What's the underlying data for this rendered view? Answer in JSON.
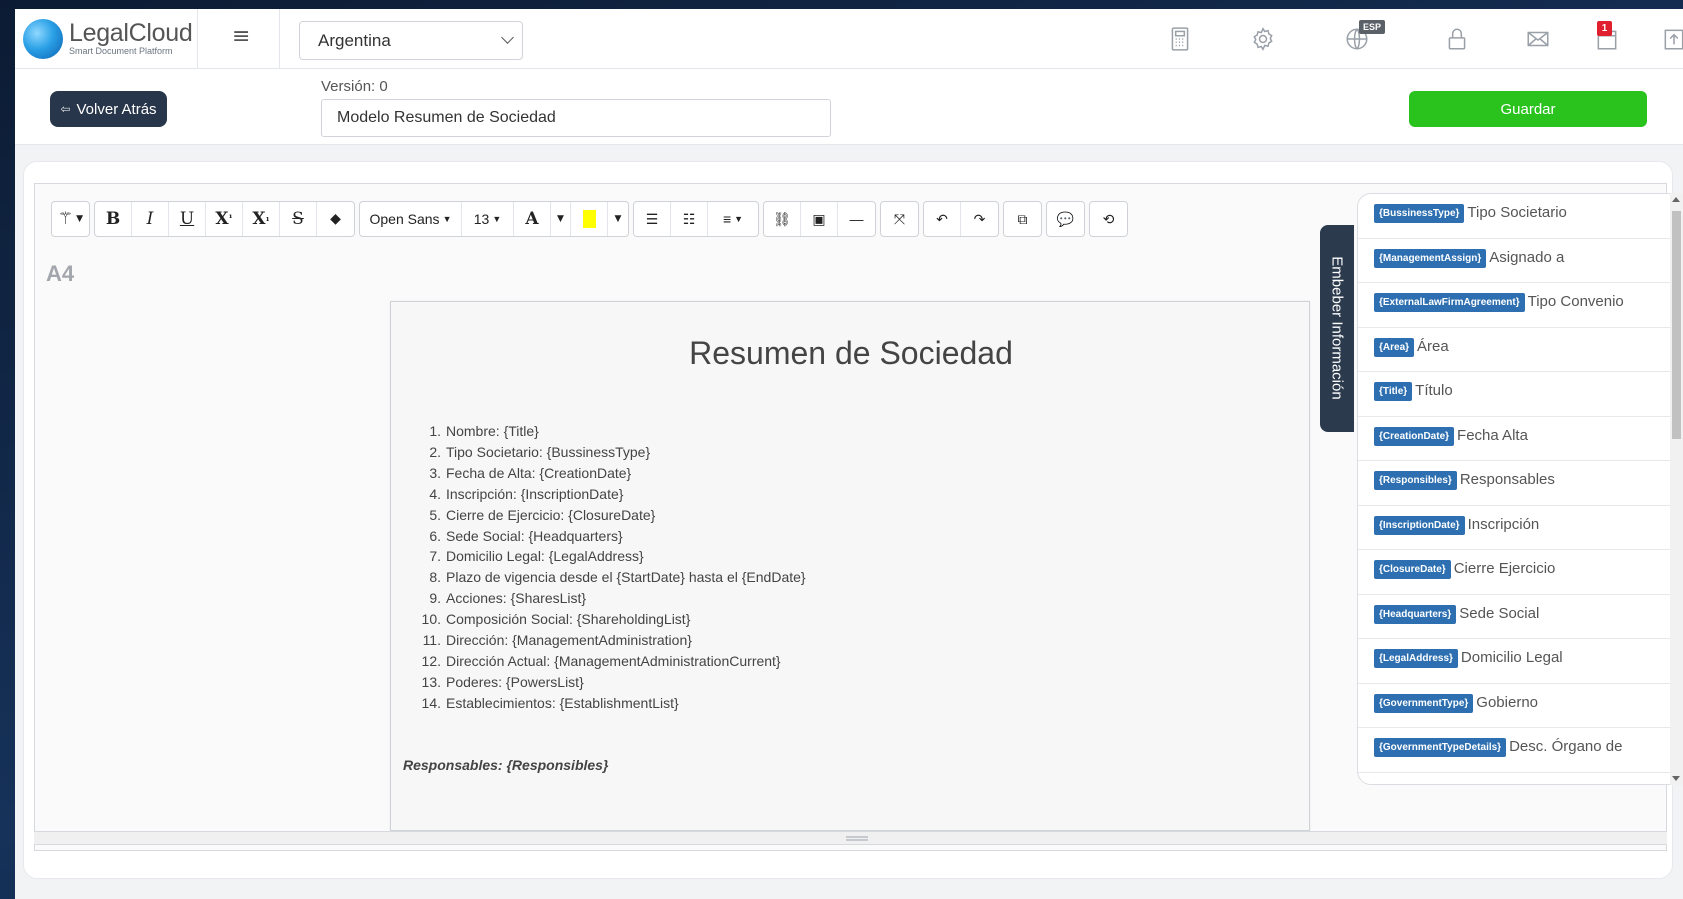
{
  "app": {
    "name": "LegalCloud",
    "tagline": "Smart Document Platform"
  },
  "header": {
    "country_selected": "Argentina",
    "lang_badge": "ESP",
    "notification_count": "1",
    "icons": [
      "calculator-icon",
      "settings-icon",
      "globe-icon",
      "lock-icon",
      "mail-icon",
      "calendar-icon",
      "upload-icon"
    ]
  },
  "subheader": {
    "back_label": "Volver Atrás",
    "version_label": "Versión: 0",
    "document_name": "Modelo Resumen de Sociedad",
    "save_label": "Guardar"
  },
  "toolbar": {
    "font_family": "Open Sans",
    "font_size": "13",
    "highlight_color": "#ffff00"
  },
  "editor": {
    "page_size": "A4",
    "title": "Resumen de Sociedad",
    "items": [
      {
        "num": "1.",
        "text": "Nombre: {Title}"
      },
      {
        "num": "2.",
        "text": "Tipo Societario: {BussinessType}"
      },
      {
        "num": "3.",
        "text": "Fecha de Alta: {CreationDate}"
      },
      {
        "num": "4.",
        "text": "Inscripción: {InscriptionDate}"
      },
      {
        "num": "5.",
        "text": "Cierre de Ejercicio: {ClosureDate}"
      },
      {
        "num": "6.",
        "text": "Sede Social: {Headquarters}"
      },
      {
        "num": "7.",
        "text": "Domicilio Legal: {LegalAddress}"
      },
      {
        "num": "8.",
        "text": "Plazo de vigencia desde el {StartDate} hasta el {EndDate}"
      },
      {
        "num": "9.",
        "text": "Acciones: {SharesList}"
      },
      {
        "num": "10.",
        "text": "Composición Social: {ShareholdingList}"
      },
      {
        "num": "11.",
        "text": "Dirección: {ManagementAdministration}"
      },
      {
        "num": "12.",
        "text": "Dirección Actual: {ManagementAdministrationCurrent}"
      },
      {
        "num": "13.",
        "text": "Poderes: {PowersList}"
      },
      {
        "num": "14.",
        "text": "Establecimientos: {EstablishmentList}"
      }
    ],
    "responsibles_line": "Responsables: {Responsibles}"
  },
  "embed_panel": {
    "tab_label": "Embeber Información",
    "variables": [
      {
        "tag": "{BussinessType}",
        "label": "Tipo Societario"
      },
      {
        "tag": "{ManagementAssign}",
        "label": "Asignado a"
      },
      {
        "tag": "{ExternalLawFirmAgreement}",
        "label": "Tipo Convenio"
      },
      {
        "tag": "{Area}",
        "label": "Área"
      },
      {
        "tag": "{Title}",
        "label": "Título"
      },
      {
        "tag": "{CreationDate}",
        "label": "Fecha Alta"
      },
      {
        "tag": "{Responsibles}",
        "label": "Responsables"
      },
      {
        "tag": "{InscriptionDate}",
        "label": "Inscripción"
      },
      {
        "tag": "{ClosureDate}",
        "label": "Cierre Ejercicio"
      },
      {
        "tag": "{Headquarters}",
        "label": "Sede Social"
      },
      {
        "tag": "{LegalAddress}",
        "label": "Domicilio Legal"
      },
      {
        "tag": "{GovernmentType}",
        "label": "Gobierno"
      },
      {
        "tag": "{GovernmentTypeDetails}",
        "label": "Desc. Órgano de"
      }
    ]
  }
}
